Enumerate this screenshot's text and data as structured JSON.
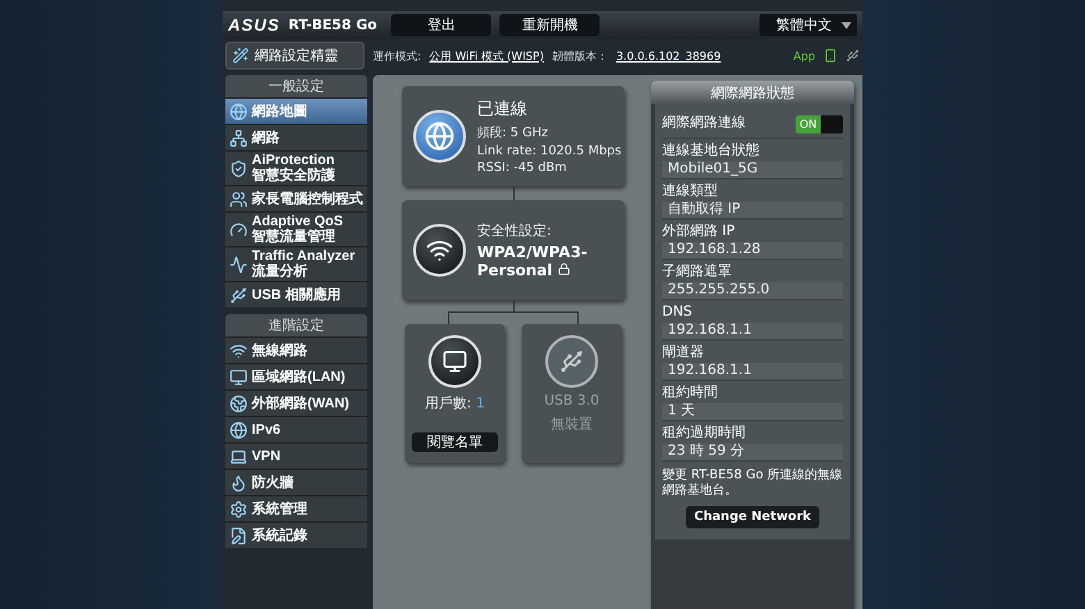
{
  "header": {
    "logo": "ASUS",
    "model": "RT-BE58 Go",
    "buttons": [
      "登出",
      "重新開機"
    ],
    "language": "繁體中文"
  },
  "quick_setup": "網路設定精靈",
  "info": {
    "mode_label": "運作模式:",
    "mode": "公用 WiFi 模式 (WISP)",
    "firmware_label": "韌體版本：",
    "firmware": "3.0.0.6.102_38969",
    "app": "App"
  },
  "sidebar": [
    {
      "title": "一般設定",
      "items": [
        {
          "lines": [
            "網路地圖"
          ],
          "selected": true
        },
        {
          "lines": [
            "網路"
          ],
          "selected": false
        },
        {
          "lines": [
            "AiProtection",
            "智慧安全防護"
          ],
          "selected": false
        },
        {
          "lines": [
            "家長電腦控制程式"
          ],
          "selected": false
        },
        {
          "lines": [
            "Adaptive QoS",
            "智慧流量管理"
          ],
          "selected": false
        },
        {
          "lines": [
            "Traffic Analyzer",
            "流量分析"
          ],
          "selected": false
        },
        {
          "lines": [
            "USB 相關應用"
          ],
          "selected": false
        }
      ]
    },
    {
      "title": "進階設定",
      "items": [
        {
          "lines": [
            "無線網路"
          ],
          "selected": false
        },
        {
          "lines": [
            "區域網路(LAN)"
          ],
          "selected": false
        },
        {
          "lines": [
            "外部網路(WAN)"
          ],
          "selected": false
        },
        {
          "lines": [
            "IPv6"
          ],
          "selected": false
        },
        {
          "lines": [
            "VPN"
          ],
          "selected": false
        },
        {
          "lines": [
            "防火牆"
          ],
          "selected": false
        },
        {
          "lines": [
            "系統管理"
          ],
          "selected": false
        },
        {
          "lines": [
            "系統記錄"
          ],
          "selected": false
        }
      ]
    }
  ],
  "map": {
    "internet": {
      "status": "已連線",
      "lines": [
        "頻段: 5 GHz",
        "Link rate: 1020.5 Mbps",
        "RSSI: -45 dBm"
      ]
    },
    "router": {
      "label": "安全性設定:",
      "value": "WPA2/WPA3-Personal"
    },
    "clients": {
      "label": "用戶數:",
      "count": "1",
      "button": "閱覽名單"
    },
    "usb": {
      "label": "USB 3.0",
      "status": "無裝置",
      "connected": false
    }
  },
  "status": {
    "title": "網際網路狀態",
    "toggle": {
      "label": "網際網路連線",
      "on": true,
      "text": "ON"
    },
    "fields": [
      {
        "label": "連線基地台狀態",
        "value": "Mobile01_5G"
      },
      {
        "label": "連線類型",
        "value": "自動取得 IP"
      },
      {
        "label": "外部網路 IP",
        "value": "192.168.1.28"
      },
      {
        "label": "子網路遮罩",
        "value": "255.255.255.0"
      },
      {
        "label": "DNS",
        "value": "192.168.1.1"
      },
      {
        "label": "閘道器",
        "value": "192.168.1.1"
      },
      {
        "label": "租約時間",
        "value": "1 天"
      },
      {
        "label": "租約過期時間",
        "value": "23 時 59 分"
      }
    ],
    "note": "變更 RT-BE58 Go 所連線的無線網路基地台。",
    "button": "Change Network"
  }
}
